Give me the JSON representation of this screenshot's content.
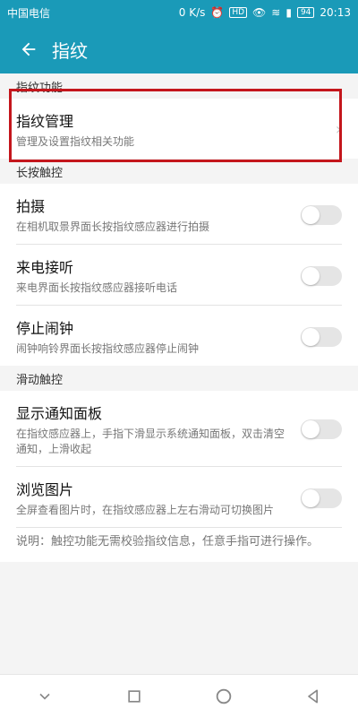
{
  "status_bar": {
    "carrier": "中国电信",
    "speed": "0 K/s",
    "hd": "HD",
    "battery": "94",
    "time": "20:13"
  },
  "app_bar": {
    "title": "指纹"
  },
  "sections": {
    "fingerprint": {
      "header": "指纹功能",
      "management": {
        "label": "指纹管理",
        "desc": "管理及设置指纹相关功能"
      }
    },
    "long_press": {
      "header": "长按触控",
      "items": [
        {
          "label": "拍摄",
          "desc": "在相机取景界面长按指纹感应器进行拍摄"
        },
        {
          "label": "来电接听",
          "desc": "来电界面长按指纹感应器接听电话"
        },
        {
          "label": "停止闹钟",
          "desc": "闹钟响铃界面长按指纹感应器停止闹钟"
        }
      ]
    },
    "swipe": {
      "header": "滑动触控",
      "items": [
        {
          "label": "显示通知面板",
          "desc": "在指纹感应器上，手指下滑显示系统通知面板，双击清空通知，上滑收起"
        },
        {
          "label": "浏览图片",
          "desc": "全屏查看图片时，在指纹感应器上左右滑动可切换图片"
        }
      ],
      "note": "说明：触控功能无需校验指纹信息，任意手指可进行操作。"
    }
  },
  "colors": {
    "accent": "#1a9ab8",
    "highlight": "#c4161c"
  }
}
